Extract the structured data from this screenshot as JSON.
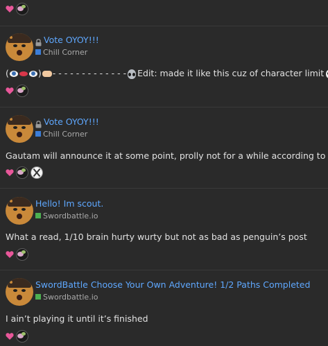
{
  "colors": {
    "background": "#2a2a2a",
    "link": "#5fa8ff",
    "heart": "#e9579a",
    "chill_corner": "#3b7dd8",
    "swordbattle": "#4caf50"
  },
  "icons": {
    "like": "heart-icon",
    "locked": "lock-icon",
    "category": "category-square-icon"
  },
  "posts": [
    {
      "topic_title": "Vote OYOY!!!",
      "locked": true,
      "category": "Chill Corner",
      "body_prefix": "(",
      "body_suffix": ")",
      "body_dashes": "- - - - - - - - - - - - -",
      "body_text": "Edit: made it like this cuz of character limit"
    },
    {
      "topic_title": "Vote OYOY!!!",
      "locked": true,
      "category": "Chill Corner",
      "body_text": "Gautam will announce it at some point, prolly not for a while according to OY"
    },
    {
      "topic_title": "Hello! Im scout.",
      "locked": false,
      "category": "Swordbattle.io",
      "body_text": "What a read, 1/10 brain hurty wurty but not as bad as penguin’s post"
    },
    {
      "topic_title": "SwordBattle Choose Your Own Adventure! 1/2 Paths Completed",
      "locked": false,
      "category": "Swordbattle.io",
      "body_text": "I ain’t playing it until it’s finished"
    }
  ]
}
